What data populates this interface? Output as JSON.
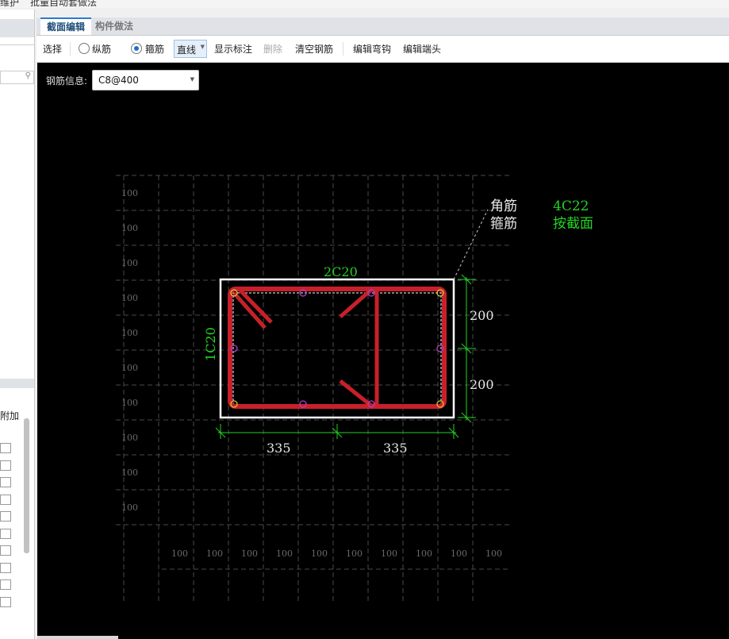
{
  "topbar": {
    "left_text": "维护",
    "right_text": "批量自动套做法"
  },
  "left_panel": {
    "column_header": "附加",
    "row_count": 10
  },
  "tabs": [
    {
      "label": "截面编辑",
      "active": true
    },
    {
      "label": "构件做法",
      "active": false
    }
  ],
  "toolbar": {
    "select_label": "选择",
    "radio_longitudinal": {
      "label": "纵筋",
      "checked": false
    },
    "radio_stirrup": {
      "label": "箍筋",
      "checked": true
    },
    "line_mode": "直线",
    "show_annotation": "显示标注",
    "delete": "删除",
    "clear_rebar": "清空钢筋",
    "edit_hook": "编辑弯钩",
    "edit_end": "编辑端头"
  },
  "rebar_info": {
    "label": "钢筋信息:",
    "value": "C8@400"
  },
  "drawing": {
    "grid_label": "100",
    "grid_rows": 10,
    "grid_cols": 10,
    "legend": [
      {
        "name": "角筋",
        "value": "4C22"
      },
      {
        "name": "箍筋",
        "value": "按截面"
      }
    ],
    "top_rebar": "2C20",
    "side_rebar": "1C20",
    "right_dims": [
      "200",
      "200"
    ],
    "bottom_dims": [
      "335",
      "335"
    ],
    "colors": {
      "stirrup": "#c8202a",
      "annotation": "#22d322",
      "dim_text": "#e8e8e8",
      "grid": "#555555",
      "section": "#ffffff"
    }
  }
}
